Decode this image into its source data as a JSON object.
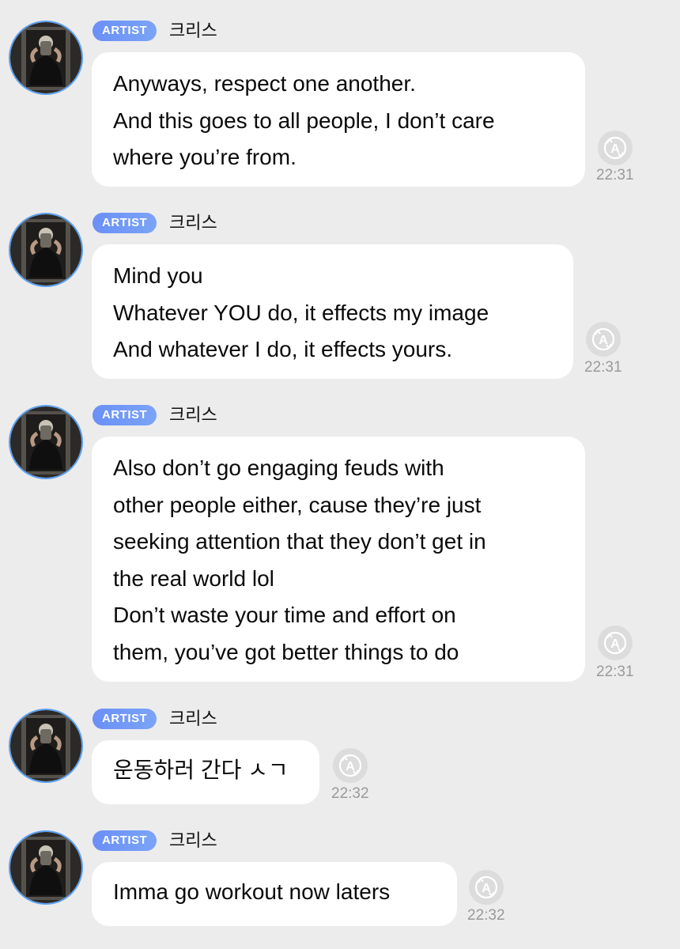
{
  "messages": [
    {
      "badge": "ARTIST",
      "sender": "크리스",
      "text": "Anyways, respect one another.\nAnd this goes to all people, I don’t care\nwhere you’re from.",
      "time": "22:31"
    },
    {
      "badge": "ARTIST",
      "sender": "크리스",
      "text": "Mind you\nWhatever YOU do, it effects my image\nAnd whatever I do, it effects yours.",
      "time": "22:31"
    },
    {
      "badge": "ARTIST",
      "sender": "크리스",
      "text": "Also don’t go engaging feuds with\nother people either, cause they’re just\nseeking attention that they don’t get in\nthe real world lol\nDon’t waste your time and effort on\nthem, you’ve got better things to do",
      "time": "22:31"
    },
    {
      "badge": "ARTIST",
      "sender": "크리스",
      "text": "운동하러 간다 ㅅㄱ",
      "time": "22:32"
    },
    {
      "badge": "ARTIST",
      "sender": "크리스",
      "text": "Imma go workout now laters",
      "time": "22:32"
    }
  ],
  "icons": {
    "translate": "translate-icon",
    "avatar": "avatar-photo"
  },
  "colors": {
    "background": "#ececec",
    "bubble": "#ffffff",
    "badge": "#6b8ff7",
    "avatar_ring": "#5aa0f2",
    "time": "#9a9a9a"
  }
}
